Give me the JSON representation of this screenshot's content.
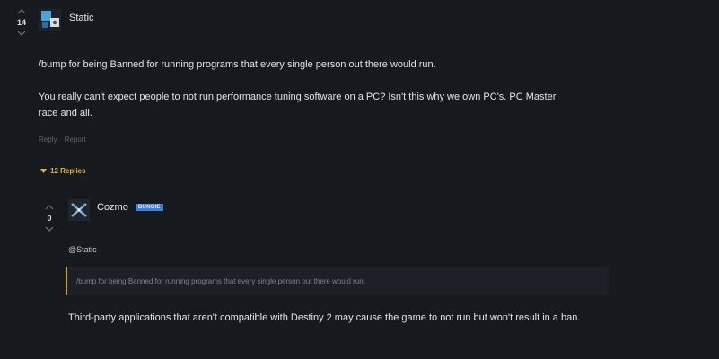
{
  "colors": {
    "background": "#16191e",
    "accent_gold": "#e0b43a",
    "badge_blue": "#3f7fd9",
    "quote_border": "#c9a43b"
  },
  "post": {
    "votes": "14",
    "username": "Static",
    "avatar_icon": "gear-cube-avatar-icon",
    "paragraphs": [
      "/bump for being Banned for running programs that every single person out there would run.",
      "You really can't expect people to not run performance tuning software on a PC? Isn't this why we own PC's. PC Master race and all."
    ],
    "actions": {
      "reply": "Reply",
      "report": "Report"
    }
  },
  "replies_toggle": {
    "label": "12 Replies",
    "icon": "caret-down-icon"
  },
  "reply": {
    "votes": "0",
    "username": "Cozmo",
    "badge": "BUNGIE",
    "avatar_icon": "bungie-x-avatar-icon",
    "mention": "@Static",
    "quote": "/bump for being Banned for running programs that every single person out there would run.",
    "body": "Third-party applications that aren't compatible with Destiny 2 may cause the game to not run but won't result in a ban."
  }
}
